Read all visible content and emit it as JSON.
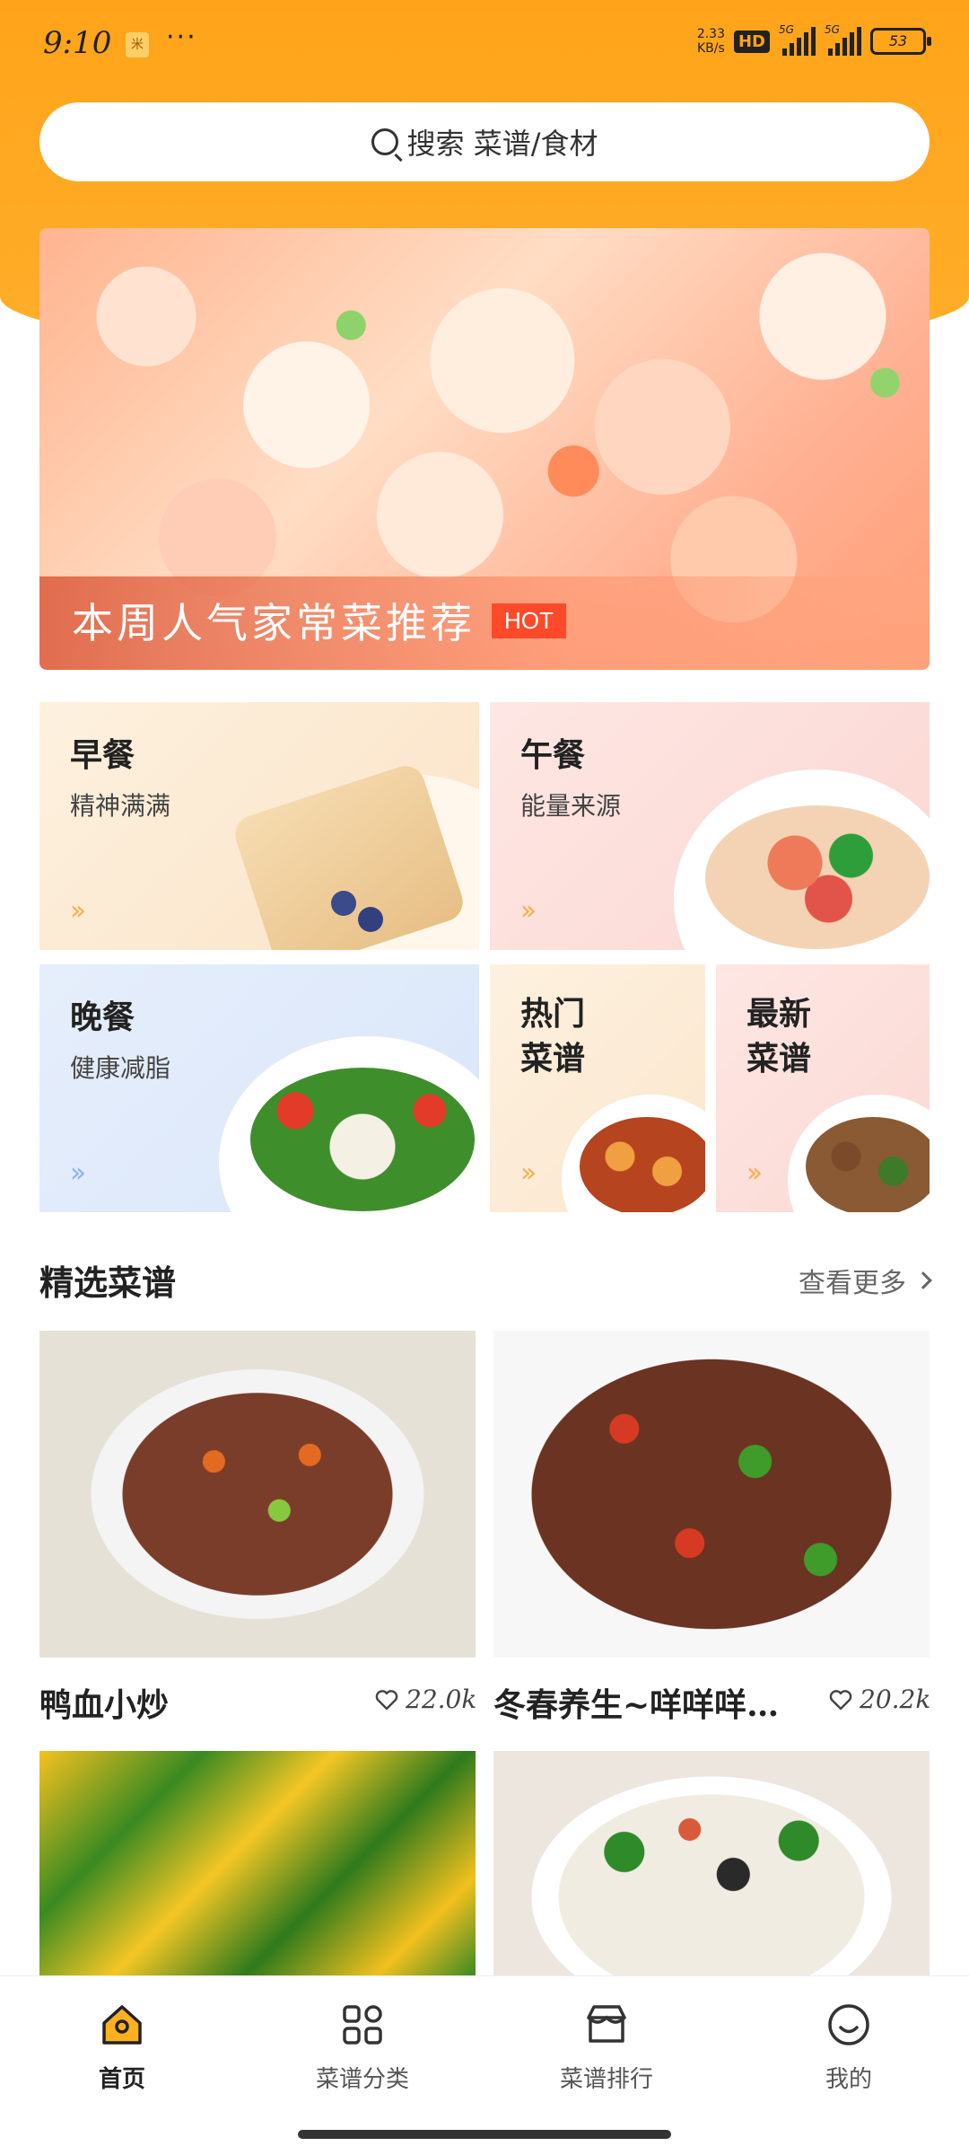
{
  "status_bar": {
    "time": "9:10",
    "sim_label": "米",
    "overflow": "···",
    "net_speed_value": "2.33",
    "net_speed_unit": "KB/s",
    "hd_badge": "HD",
    "sig1_label": "5G",
    "sig2_label": "5G",
    "battery": "53"
  },
  "search": {
    "icon": "search-icon",
    "placeholder": "搜索 菜谱/食材"
  },
  "banner": {
    "title": "本周人气家常菜推荐",
    "badge": "HOT"
  },
  "categories": [
    {
      "title": "早餐",
      "subtitle": "精神满满"
    },
    {
      "title": "午餐",
      "subtitle": "能量来源"
    },
    {
      "title": "晚餐",
      "subtitle": "健康减脂"
    },
    {
      "title": "热门\n菜谱"
    },
    {
      "title": "最新\n菜谱"
    }
  ],
  "featured": {
    "title": "精选菜谱",
    "more_label": "查看更多"
  },
  "recipes": [
    {
      "name": "鸭血小炒",
      "likes": "22.0k"
    },
    {
      "name": "冬春养生~咩咩咩…",
      "likes": "20.2k"
    }
  ],
  "nav": [
    {
      "label": "首页",
      "icon": "home-icon",
      "active": true
    },
    {
      "label": "菜谱分类",
      "icon": "grid-icon",
      "active": false
    },
    {
      "label": "菜谱排行",
      "icon": "shop-icon",
      "active": false
    },
    {
      "label": "我的",
      "icon": "smile-icon",
      "active": false
    }
  ],
  "colors": {
    "accent": "#ffa41a",
    "hot_badge": "#ff4a2a"
  }
}
